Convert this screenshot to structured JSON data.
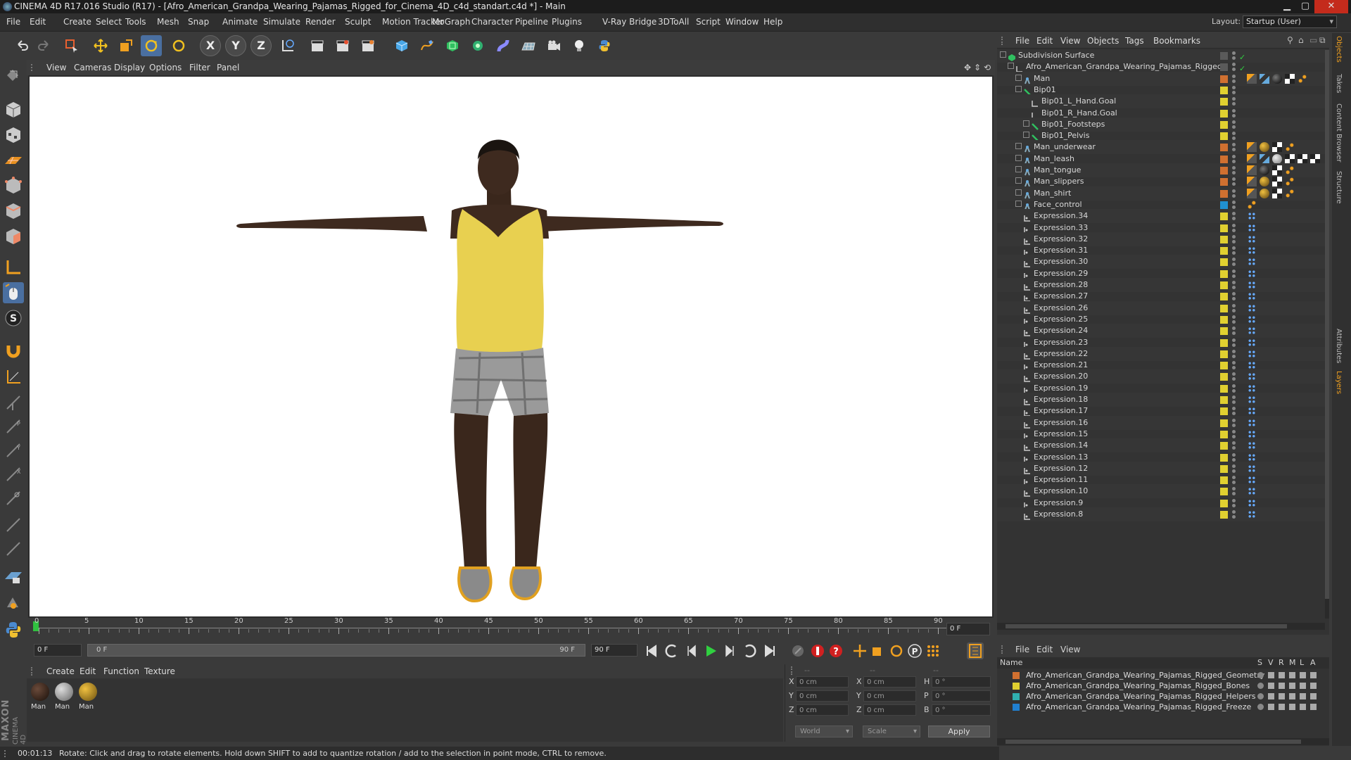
{
  "window": {
    "title": "CINEMA 4D R17.016 Studio (R17) - [Afro_American_Grandpa_Wearing_Pajamas_Rigged_for_Cinema_4D_c4d_standart.c4d *] - Main",
    "minimize": "▁",
    "maximize": "▢",
    "close": "✕"
  },
  "menubar": {
    "items": [
      "File",
      "Edit",
      "Create",
      "Select",
      "Tools",
      "Mesh",
      "Snap",
      "Animate",
      "Simulate",
      "Render",
      "Sculpt",
      "Motion Tracker",
      "MoGraph",
      "Character",
      "Pipeline",
      "Plugins",
      "V-Ray Bridge",
      "3DToAll",
      "Script",
      "Window",
      "Help"
    ],
    "layout_label": "Layout:",
    "layout_value": "Startup (User)"
  },
  "toolbar": {
    "axis_x": "X",
    "axis_y": "Y",
    "axis_z": "Z"
  },
  "viewport": {
    "menu": [
      "View",
      "Cameras",
      "Display",
      "Options",
      "Filter",
      "Panel"
    ]
  },
  "timeline": {
    "ticks": [
      "0",
      "5",
      "10",
      "15",
      "20",
      "25",
      "30",
      "35",
      "40",
      "45",
      "50",
      "55",
      "60",
      "65",
      "70",
      "75",
      "80",
      "85",
      "90"
    ],
    "current_frame": "0 F",
    "start_frame": "0 F",
    "range_start": "0 F",
    "range_end": "90 F",
    "end_frame": "90 F"
  },
  "material": {
    "menu": [
      "Create",
      "Edit",
      "Function",
      "Texture"
    ],
    "items": [
      "Man",
      "Man",
      "Man"
    ]
  },
  "coords": {
    "header": [
      "--",
      "--",
      "--"
    ],
    "rows": [
      {
        "a": "X",
        "av": "0 cm",
        "b": "X",
        "bv": "0 cm",
        "c": "H",
        "cv": "0 °"
      },
      {
        "a": "Y",
        "av": "0 cm",
        "b": "Y",
        "bv": "0 cm",
        "c": "P",
        "cv": "0 °"
      },
      {
        "a": "Z",
        "av": "0 cm",
        "b": "Z",
        "bv": "0 cm",
        "c": "B",
        "cv": "0 °"
      }
    ],
    "world": "World",
    "scale": "Scale",
    "apply": "Apply"
  },
  "status": {
    "time": "00:01:13",
    "message": "Rotate: Click and drag to rotate elements. Hold down SHIFT to add to quantize rotation / add to the selection in point mode, CTRL to remove."
  },
  "object_manager": {
    "menu": [
      "File",
      "Edit",
      "View",
      "Objects",
      "Tags",
      "Bookmarks"
    ],
    "rows": [
      {
        "name": "Subdivision Surface",
        "indent": 0,
        "icon": "subdiv",
        "color": "#5a5a5a",
        "tags": []
      },
      {
        "name": "Afro_American_Grandpa_Wearing_Pajamas_Rigged",
        "indent": 1,
        "icon": "null",
        "color": "#5a5a5a",
        "tags": []
      },
      {
        "name": "Man",
        "indent": 2,
        "icon": "joint",
        "color": "#d07030",
        "tags": [
          "weight",
          "ik",
          "sphere",
          "checker",
          "dots"
        ]
      },
      {
        "name": "Bip01",
        "indent": 2,
        "icon": "bone",
        "color": "#e0d030",
        "tags": []
      },
      {
        "name": "Bip01_L_Hand.Goal",
        "indent": 3,
        "icon": "null",
        "color": "#e0d030",
        "tags": []
      },
      {
        "name": "Bip01_R_Hand.Goal",
        "indent": 3,
        "icon": "null",
        "color": "#e0d030",
        "tags": []
      },
      {
        "name": "Bip01_Footsteps",
        "indent": 3,
        "icon": "bone",
        "color": "#e0d030",
        "tags": []
      },
      {
        "name": "Bip01_Pelvis",
        "indent": 3,
        "icon": "bone",
        "color": "#e0d030",
        "tags": []
      },
      {
        "name": "Man_underwear",
        "indent": 2,
        "icon": "joint",
        "color": "#d07030",
        "tags": [
          "weight",
          "mat",
          "checker",
          "dots"
        ]
      },
      {
        "name": "Man_leash",
        "indent": 2,
        "icon": "joint",
        "color": "#d07030",
        "tags": [
          "weight",
          "ik",
          "grey",
          "checker",
          "checker",
          "checker"
        ]
      },
      {
        "name": "Man_tongue",
        "indent": 2,
        "icon": "joint",
        "color": "#d07030",
        "tags": [
          "weight",
          "sphere",
          "checker",
          "dots"
        ]
      },
      {
        "name": "Man_slippers",
        "indent": 2,
        "icon": "joint",
        "color": "#d07030",
        "tags": [
          "weight",
          "mat",
          "checker",
          "dots"
        ]
      },
      {
        "name": "Man_shirt",
        "indent": 2,
        "icon": "joint",
        "color": "#d07030",
        "tags": [
          "weight",
          "mat",
          "checker",
          "dots"
        ]
      },
      {
        "name": "Face_control",
        "indent": 2,
        "icon": "joint",
        "color": "#2090d0",
        "tags": [
          "dots"
        ]
      },
      {
        "name": "Expression.34",
        "indent": 2,
        "icon": "expr",
        "color": "#e0d030",
        "tags": [
          "xpresso"
        ]
      },
      {
        "name": "Expression.33",
        "indent": 2,
        "icon": "expr",
        "color": "#e0d030",
        "tags": [
          "xpresso"
        ]
      },
      {
        "name": "Expression.32",
        "indent": 2,
        "icon": "expr",
        "color": "#e0d030",
        "tags": [
          "xpresso"
        ]
      },
      {
        "name": "Expression.31",
        "indent": 2,
        "icon": "expr",
        "color": "#e0d030",
        "tags": [
          "xpresso"
        ]
      },
      {
        "name": "Expression.30",
        "indent": 2,
        "icon": "expr",
        "color": "#e0d030",
        "tags": [
          "xpresso"
        ]
      },
      {
        "name": "Expression.29",
        "indent": 2,
        "icon": "expr",
        "color": "#e0d030",
        "tags": [
          "xpresso"
        ]
      },
      {
        "name": "Expression.28",
        "indent": 2,
        "icon": "expr",
        "color": "#e0d030",
        "tags": [
          "xpresso"
        ]
      },
      {
        "name": "Expression.27",
        "indent": 2,
        "icon": "expr",
        "color": "#e0d030",
        "tags": [
          "xpresso"
        ]
      },
      {
        "name": "Expression.26",
        "indent": 2,
        "icon": "expr",
        "color": "#e0d030",
        "tags": [
          "xpresso"
        ]
      },
      {
        "name": "Expression.25",
        "indent": 2,
        "icon": "expr",
        "color": "#e0d030",
        "tags": [
          "xpresso"
        ]
      },
      {
        "name": "Expression.24",
        "indent": 2,
        "icon": "expr",
        "color": "#e0d030",
        "tags": [
          "xpresso"
        ]
      },
      {
        "name": "Expression.23",
        "indent": 2,
        "icon": "expr",
        "color": "#e0d030",
        "tags": [
          "xpresso"
        ]
      },
      {
        "name": "Expression.22",
        "indent": 2,
        "icon": "expr",
        "color": "#e0d030",
        "tags": [
          "xpresso"
        ]
      },
      {
        "name": "Expression.21",
        "indent": 2,
        "icon": "expr",
        "color": "#e0d030",
        "tags": [
          "xpresso"
        ]
      },
      {
        "name": "Expression.20",
        "indent": 2,
        "icon": "expr",
        "color": "#e0d030",
        "tags": [
          "xpresso"
        ]
      },
      {
        "name": "Expression.19",
        "indent": 2,
        "icon": "expr",
        "color": "#e0d030",
        "tags": [
          "xpresso"
        ]
      },
      {
        "name": "Expression.18",
        "indent": 2,
        "icon": "expr",
        "color": "#e0d030",
        "tags": [
          "xpresso"
        ]
      },
      {
        "name": "Expression.17",
        "indent": 2,
        "icon": "expr",
        "color": "#e0d030",
        "tags": [
          "xpresso"
        ]
      },
      {
        "name": "Expression.16",
        "indent": 2,
        "icon": "expr",
        "color": "#e0d030",
        "tags": [
          "xpresso"
        ]
      },
      {
        "name": "Expression.15",
        "indent": 2,
        "icon": "expr",
        "color": "#e0d030",
        "tags": [
          "xpresso"
        ]
      },
      {
        "name": "Expression.14",
        "indent": 2,
        "icon": "expr",
        "color": "#e0d030",
        "tags": [
          "xpresso"
        ]
      },
      {
        "name": "Expression.13",
        "indent": 2,
        "icon": "expr",
        "color": "#e0d030",
        "tags": [
          "xpresso"
        ]
      },
      {
        "name": "Expression.12",
        "indent": 2,
        "icon": "expr",
        "color": "#e0d030",
        "tags": [
          "xpresso"
        ]
      },
      {
        "name": "Expression.11",
        "indent": 2,
        "icon": "expr",
        "color": "#e0d030",
        "tags": [
          "xpresso"
        ]
      },
      {
        "name": "Expression.10",
        "indent": 2,
        "icon": "expr",
        "color": "#e0d030",
        "tags": [
          "xpresso"
        ]
      },
      {
        "name": "Expression.9",
        "indent": 2,
        "icon": "expr",
        "color": "#e0d030",
        "tags": [
          "xpresso"
        ]
      },
      {
        "name": "Expression.8",
        "indent": 2,
        "icon": "expr",
        "color": "#e0d030",
        "tags": [
          "xpresso"
        ]
      }
    ]
  },
  "layer_manager": {
    "menu": [
      "File",
      "Edit",
      "View"
    ],
    "header": {
      "name": "Name",
      "cols": [
        "S",
        "V",
        "R",
        "M",
        "L",
        "A"
      ]
    },
    "layers": [
      {
        "name": "Afro_American_Grandpa_Wearing_Pajamas_Rigged_Geometry",
        "color": "#d07030"
      },
      {
        "name": "Afro_American_Grandpa_Wearing_Pajamas_Rigged_Bones",
        "color": "#e0d030"
      },
      {
        "name": "Afro_American_Grandpa_Wearing_Pajamas_Rigged_Helpers",
        "color": "#30b0b0"
      },
      {
        "name": "Afro_American_Grandpa_Wearing_Pajamas_Rigged_Freeze",
        "color": "#2080d0"
      }
    ]
  },
  "right_tabs": [
    "Objects",
    "Takes",
    "Content Browser",
    "Structure",
    "Attributes",
    "Layers"
  ],
  "brand": {
    "maxon": "MAXON",
    "cinema": "CINEMA 4D"
  }
}
